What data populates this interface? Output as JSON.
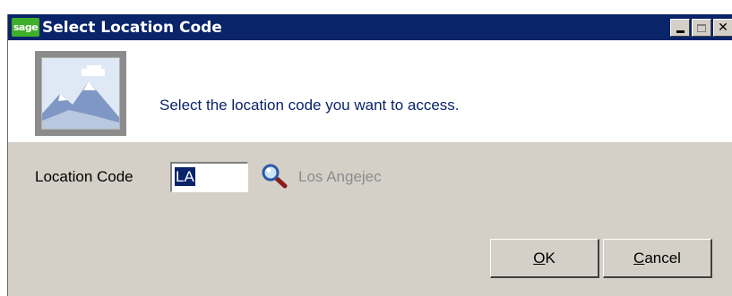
{
  "window": {
    "title": "Select Location Code",
    "logo_text": "sage",
    "controls": {
      "minimize": "minimize",
      "maximize": "maximize",
      "close": "✕"
    }
  },
  "header": {
    "image_icon": "mountain-landscape-icon",
    "message": "Select the location code you want to access."
  },
  "form": {
    "location_label": "Location Code",
    "location_value": "LA",
    "lookup_icon": "magnifier-icon",
    "location_name": "Los Angejec"
  },
  "buttons": {
    "ok_mnemonic": "O",
    "ok_rest": "K",
    "cancel_mnemonic": "C",
    "cancel_rest": "ancel"
  },
  "colors": {
    "titlebar": "#0a246a",
    "dialog_bg": "#d4d0c8",
    "message_text": "#0a246a",
    "selection": "#0a246a"
  }
}
